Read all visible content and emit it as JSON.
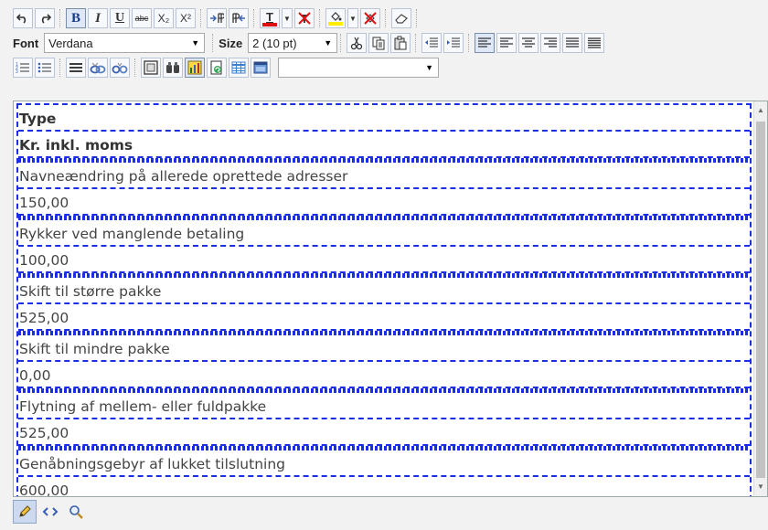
{
  "toolbar": {
    "row1": {
      "bold": "B",
      "italic": "I",
      "underline": "U",
      "strike": "abc",
      "subscript": "X₂",
      "superscript": "X²",
      "text_color": "T"
    },
    "font_label": "Font",
    "font_value": "Verdana",
    "size_label": "Size",
    "size_value": "2 (10 pt)",
    "style_value": ""
  },
  "colors": {
    "table_border": "#1a2ee6",
    "text_color_bar": "#e01010",
    "highlight_bar": "#ffee00"
  },
  "table": {
    "headers": [
      "Type",
      "Kr. inkl. moms"
    ],
    "rows": [
      {
        "type": "Navneændring på allerede oprettede adresser",
        "price": "150,00"
      },
      {
        "type": "Rykker ved manglende betaling",
        "price": "100,00"
      },
      {
        "type": "Skift til større pakke",
        "price": "525,00"
      },
      {
        "type": "Skift til mindre pakke",
        "price": "0,00"
      },
      {
        "type": "Flytning af mellem- eller fuldpakke",
        "price": "525,00"
      },
      {
        "type": "Genåbningsgebyr af lukket tilslutning",
        "price": "600,00"
      }
    ]
  },
  "modes": [
    "pencil-icon",
    "html-code-icon",
    "preview-magnifier-icon"
  ]
}
